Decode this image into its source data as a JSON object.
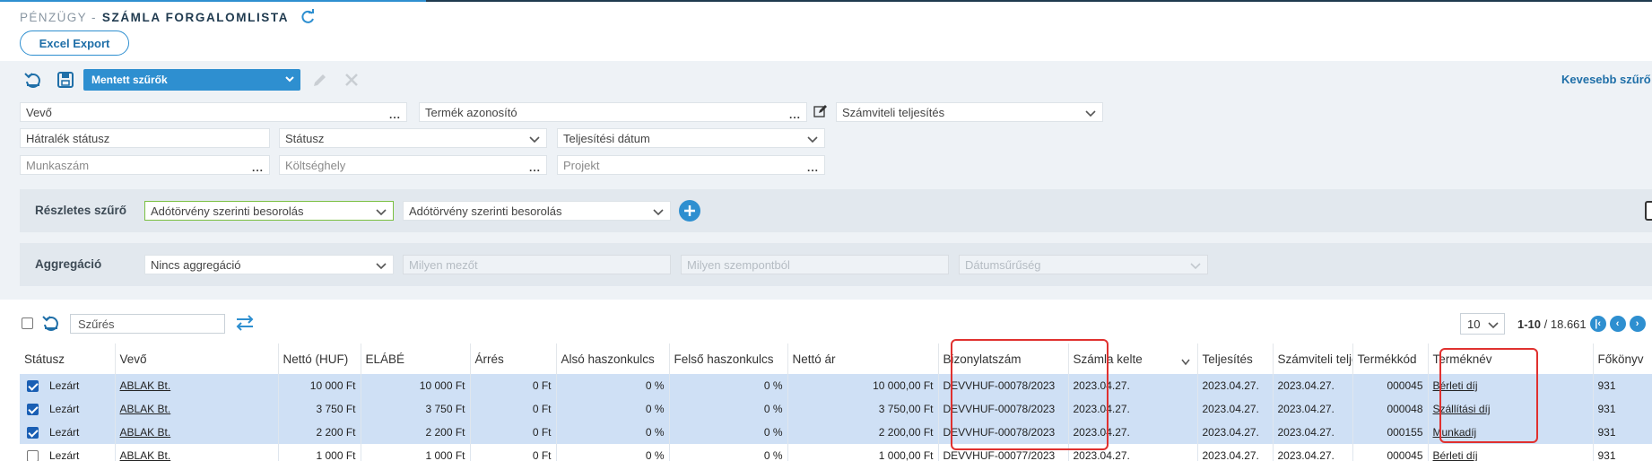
{
  "header": {
    "prefix": "PÉNZÜGY -",
    "title": "SZÁMLA FORGALOMLISTA",
    "refresh_icon": "refresh-icon"
  },
  "excel_export_label": "Excel Export",
  "toolbar": {
    "saved_filters_label": "Mentett szűrők",
    "less_filters_label": "Kevesebb szűrő"
  },
  "filters": {
    "vevo": "Vevő",
    "termek_azonosito": "Termék azonosító",
    "szamviteli_teljesites": "Számviteli teljesítés",
    "hatralek_statusz": "Hátralék státusz",
    "statusz": "Státusz",
    "teljesitesi_datum": "Teljesítési dátum",
    "munkaszam": "Munkaszám",
    "koltseghely": "Költséghely",
    "projekt": "Projekt",
    "dots": "..."
  },
  "detailed_filter": {
    "label": "Részletes szűrő",
    "select1": "Adótörvény szerinti besorolás",
    "select2": "Adótörvény szerinti besorolás"
  },
  "aggregation": {
    "label": "Aggregáció",
    "select": "Nincs aggregáció",
    "field1": "Milyen mezőt",
    "field2": "Milyen szempontból",
    "field3": "Dátumsűrűség"
  },
  "list": {
    "search_placeholder": "Szűrés",
    "page_size": "10",
    "page_range": "1-10",
    "page_total": " / 18.661"
  },
  "columns": [
    "Státusz",
    "Vevő",
    "Nettó (HUF)",
    "ELÁBÉ",
    "Árrés",
    "Alsó haszonkulcs",
    "Felső haszonkulcs",
    "Nettó ár",
    "Bizonylatszám",
    "Számla kelte",
    "Teljesítés",
    "Számviteli teljesítés",
    "Termékkód",
    "Terméknév",
    "Főkönyv"
  ],
  "rows": [
    {
      "selected": true,
      "statusz": "Lezárt",
      "vevo": "ABLAK Bt.",
      "netto": "10 000 Ft",
      "elabe": "10 000 Ft",
      "arres": "0 Ft",
      "also": "0 %",
      "felso": "0 %",
      "netto_ar": "10 000,00 Ft",
      "bizonylat": "DEVVHUF-00078/2023",
      "kelte": "2023.04.27.",
      "teljesites": "2023.04.27.",
      "szamviteli": "2023.04.27.",
      "kod": "000045",
      "nev": "Bérleti díj",
      "fokonyv": "931"
    },
    {
      "selected": true,
      "statusz": "Lezárt",
      "vevo": "ABLAK Bt.",
      "netto": "3 750 Ft",
      "elabe": "3 750 Ft",
      "arres": "0 Ft",
      "also": "0 %",
      "felso": "0 %",
      "netto_ar": "3 750,00 Ft",
      "bizonylat": "DEVVHUF-00078/2023",
      "kelte": "2023.04.27.",
      "teljesites": "2023.04.27.",
      "szamviteli": "2023.04.27.",
      "kod": "000048",
      "nev": "Szállítási díj",
      "fokonyv": "931"
    },
    {
      "selected": true,
      "statusz": "Lezárt",
      "vevo": "ABLAK Bt.",
      "netto": "2 200 Ft",
      "elabe": "2 200 Ft",
      "arres": "0 Ft",
      "also": "0 %",
      "felso": "0 %",
      "netto_ar": "2 200,00 Ft",
      "bizonylat": "DEVVHUF-00078/2023",
      "kelte": "2023.04.27.",
      "teljesites": "2023.04.27.",
      "szamviteli": "2023.04.27.",
      "kod": "000155",
      "nev": "Munkadíj",
      "fokonyv": "931"
    },
    {
      "selected": false,
      "statusz": "Lezárt",
      "vevo": "ABLAK Bt.",
      "netto": "1 000 Ft",
      "elabe": "1 000 Ft",
      "arres": "0 Ft",
      "also": "0 %",
      "felso": "0 %",
      "netto_ar": "1 000,00 Ft",
      "bizonylat": "DEVVHUF-00077/2023",
      "kelte": "2023.04.27.",
      "teljesites": "2023.04.27.",
      "szamviteli": "2023.04.27.",
      "kod": "000045",
      "nev": "Bérleti díj",
      "fokonyv": "931"
    }
  ],
  "colors": {
    "accent": "#2e8fd0",
    "selected_row": "#cfe0f5",
    "highlight": "#e0312f"
  }
}
